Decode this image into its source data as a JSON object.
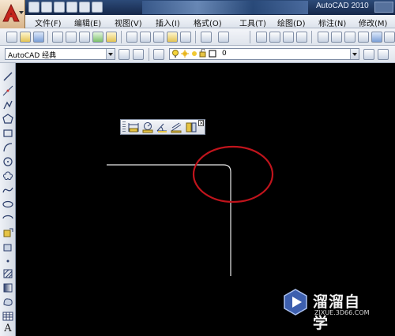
{
  "window": {
    "title": "AutoCAD 2010"
  },
  "menu": {
    "items": [
      "文件(F)",
      "编辑(E)",
      "视图(V)",
      "插入(I)",
      "格式(O)",
      "工具(T)",
      "绘图(D)",
      "标注(N)",
      "修改(M)"
    ]
  },
  "toolbar": {
    "workspace_value": "AutoCAD 经典",
    "layer_value": "0"
  },
  "annotation": {
    "highlight_color": "#c0141c"
  },
  "drawing": {
    "line_color": "#e8e8e8"
  },
  "watermark": {
    "brand": "溜溜自学",
    "url": "ZIXUE.3D66.COM"
  }
}
